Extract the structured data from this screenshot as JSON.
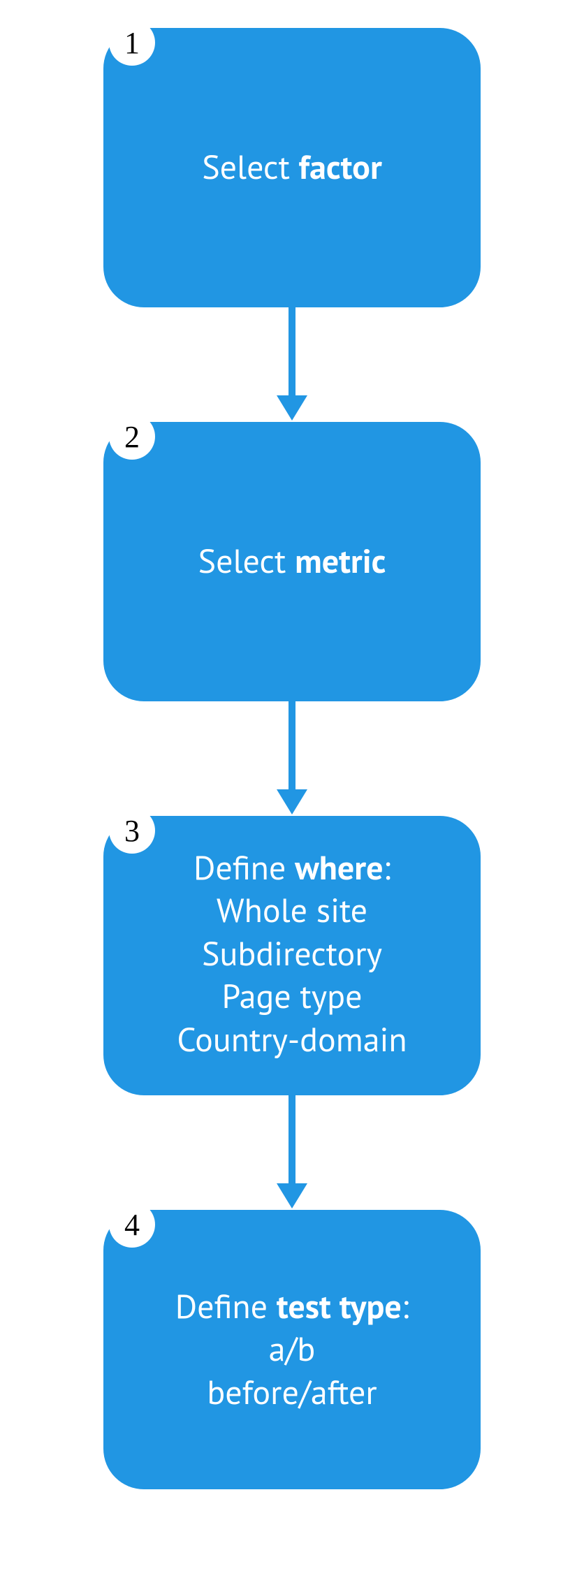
{
  "colors": {
    "primary": "#2196e3",
    "badge_bg": "#ffffff",
    "badge_text": "#000000",
    "text": "#ffffff"
  },
  "steps": [
    {
      "number": "1",
      "lines": [
        {
          "prefix": "Select ",
          "bold": "factor",
          "suffix": ""
        }
      ]
    },
    {
      "number": "2",
      "lines": [
        {
          "prefix": "Select ",
          "bold": "metric",
          "suffix": ""
        }
      ]
    },
    {
      "number": "3",
      "lines": [
        {
          "prefix": "Define ",
          "bold": "where",
          "suffix": ":"
        },
        {
          "prefix": "Whole site",
          "bold": "",
          "suffix": ""
        },
        {
          "prefix": "Subdirectory",
          "bold": "",
          "suffix": ""
        },
        {
          "prefix": "Page type",
          "bold": "",
          "suffix": ""
        },
        {
          "prefix": "Country-domain",
          "bold": "",
          "suffix": ""
        }
      ]
    },
    {
      "number": "4",
      "lines": [
        {
          "prefix": "Define ",
          "bold": "test type",
          "suffix": ":"
        },
        {
          "prefix": "a/b",
          "bold": "",
          "suffix": ""
        },
        {
          "prefix": "before/after",
          "bold": "",
          "suffix": ""
        }
      ]
    }
  ]
}
